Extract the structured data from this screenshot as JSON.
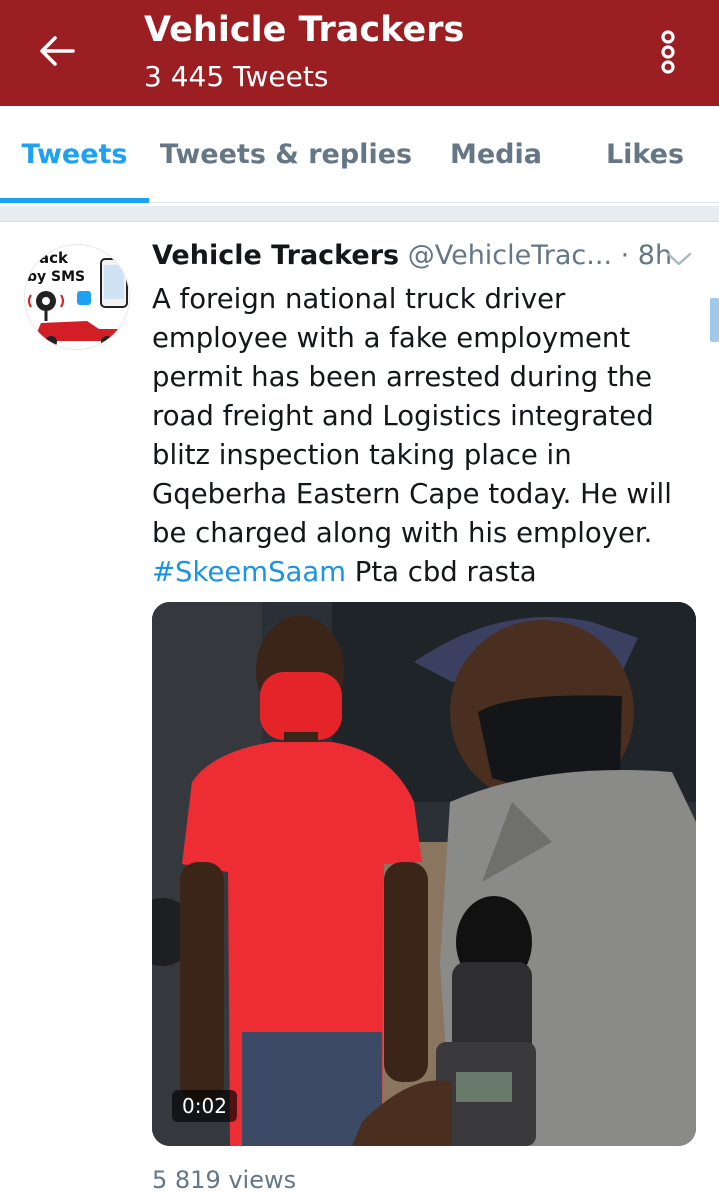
{
  "header": {
    "title": "Vehicle Trackers",
    "subtitle": "3 445 Tweets",
    "bg_color": "#9b1e22"
  },
  "tabs": [
    {
      "label": "Tweets",
      "active": true
    },
    {
      "label": "Tweets & replies",
      "active": false
    },
    {
      "label": "Media",
      "active": false
    },
    {
      "label": "Likes",
      "active": false
    }
  ],
  "accent_color": "#1da1f2",
  "tweet": {
    "author_name": "Vehicle Trackers",
    "author_handle": "@VehicleTrac...",
    "time": "· 8h",
    "text": "A foreign national truck driver employee with a fake employment permit has been arrested during the road freight and Logistics integrated blitz inspection taking place in Gqeberha Eastern Cape today. He will be charged along with his employer.",
    "hashtag": "#SkeemSaam",
    "text_after_hashtag": " Pta cbd rasta",
    "avatar_text_1": "ack",
    "avatar_text_2": "by SMS",
    "video_duration": "0:02",
    "views": "5 819 views"
  },
  "icons": {
    "back": "arrow-left-icon",
    "overflow": "vertical-dots-icon",
    "caret": "chevron-down-icon"
  }
}
